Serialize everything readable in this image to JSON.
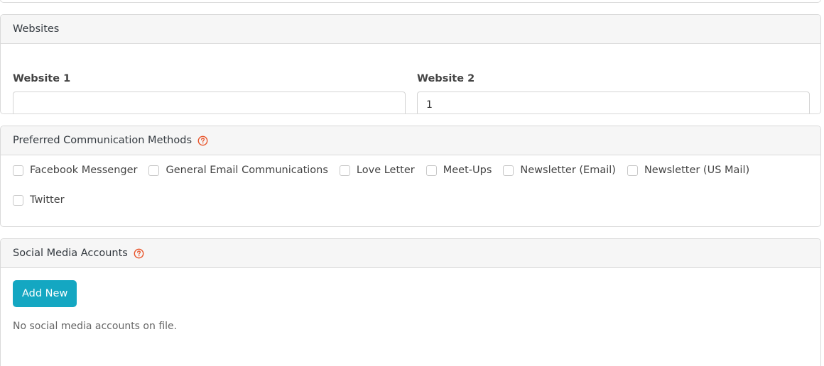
{
  "websites": {
    "title": "Websites",
    "website1": {
      "label": "Website 1",
      "value": ""
    },
    "website2": {
      "label": "Website 2",
      "value": "1"
    }
  },
  "communication": {
    "title": "Preferred Communication Methods",
    "help_icon": "question-circle-icon",
    "options": [
      {
        "label": "Facebook Messenger",
        "checked": false
      },
      {
        "label": "General Email Communications",
        "checked": false
      },
      {
        "label": "Love Letter",
        "checked": false
      },
      {
        "label": "Meet-Ups",
        "checked": false
      },
      {
        "label": "Newsletter (Email)",
        "checked": false
      },
      {
        "label": "Newsletter (US Mail)",
        "checked": false
      },
      {
        "label": "Twitter",
        "checked": false
      }
    ]
  },
  "social": {
    "title": "Social Media Accounts",
    "help_icon": "question-circle-icon",
    "add_button": "Add New",
    "empty_message": "No social media accounts on file."
  },
  "colors": {
    "accent": "#14a7c2",
    "help_icon": "#e8542a",
    "header_bg": "#f6f6f6",
    "border": "#d9d9d9"
  }
}
